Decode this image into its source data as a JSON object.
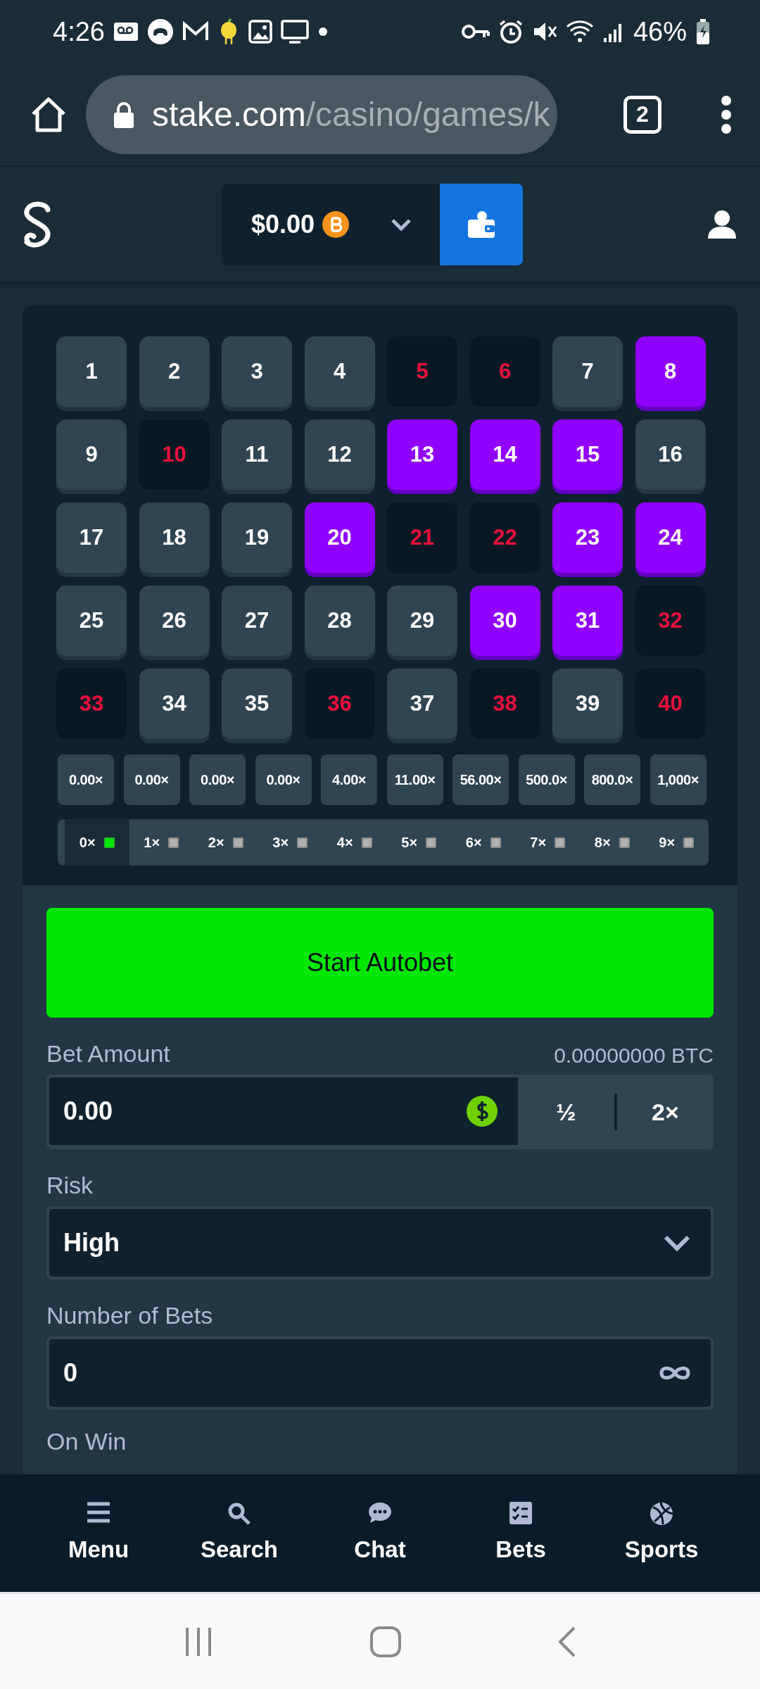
{
  "status_bar": {
    "time": "4:26",
    "battery": "46%"
  },
  "browser": {
    "url_host": "stake.com",
    "url_path": "/casino/games/k",
    "tab_count": "2"
  },
  "header": {
    "balance": "$0.00"
  },
  "board": {
    "rows": [
      {
        "tiles": [
          {
            "number": "1",
            "kind": "closed"
          },
          {
            "number": "2",
            "kind": "closed"
          },
          {
            "number": "3",
            "kind": "closed"
          },
          {
            "number": "4",
            "kind": "closed"
          },
          {
            "number": "5",
            "kind": "miss"
          },
          {
            "number": "6",
            "kind": "miss"
          },
          {
            "number": "7",
            "kind": "closed"
          },
          {
            "number": "8",
            "kind": "selected"
          }
        ]
      },
      {
        "tiles": [
          {
            "number": "9",
            "kind": "closed"
          },
          {
            "number": "10",
            "kind": "miss"
          },
          {
            "number": "11",
            "kind": "closed"
          },
          {
            "number": "12",
            "kind": "closed"
          },
          {
            "number": "13",
            "kind": "selected"
          },
          {
            "number": "14",
            "kind": "selected"
          },
          {
            "number": "15",
            "kind": "selected"
          },
          {
            "number": "16",
            "kind": "closed"
          }
        ]
      },
      {
        "tiles": [
          {
            "number": "17",
            "kind": "closed"
          },
          {
            "number": "18",
            "kind": "closed"
          },
          {
            "number": "19",
            "kind": "closed"
          },
          {
            "number": "20",
            "kind": "selected"
          },
          {
            "number": "21",
            "kind": "miss"
          },
          {
            "number": "22",
            "kind": "miss"
          },
          {
            "number": "23",
            "kind": "selected"
          },
          {
            "number": "24",
            "kind": "selected"
          }
        ]
      },
      {
        "tiles": [
          {
            "number": "25",
            "kind": "closed"
          },
          {
            "number": "26",
            "kind": "closed"
          },
          {
            "number": "27",
            "kind": "closed"
          },
          {
            "number": "28",
            "kind": "closed"
          },
          {
            "number": "29",
            "kind": "closed"
          },
          {
            "number": "30",
            "kind": "selected"
          },
          {
            "number": "31",
            "kind": "selected"
          },
          {
            "number": "32",
            "kind": "miss"
          }
        ]
      },
      {
        "tiles": [
          {
            "number": "33",
            "kind": "miss"
          },
          {
            "number": "34",
            "kind": "closed"
          },
          {
            "number": "35",
            "kind": "closed"
          },
          {
            "number": "36",
            "kind": "miss"
          },
          {
            "number": "37",
            "kind": "closed"
          },
          {
            "number": "38",
            "kind": "miss"
          },
          {
            "number": "39",
            "kind": "closed"
          },
          {
            "number": "40",
            "kind": "miss"
          }
        ]
      }
    ],
    "payouts": [
      "0.00×",
      "0.00×",
      "0.00×",
      "0.00×",
      "4.00×",
      "11.00×",
      "56.00×",
      "500.0×",
      "800.0×",
      "1,000×"
    ],
    "hits": [
      {
        "label": "0×",
        "selected": true
      },
      {
        "label": "1×",
        "selected": false
      },
      {
        "label": "2×",
        "selected": false
      },
      {
        "label": "3×",
        "selected": false
      },
      {
        "label": "4×",
        "selected": false
      },
      {
        "label": "5×",
        "selected": false
      },
      {
        "label": "6×",
        "selected": false
      },
      {
        "label": "7×",
        "selected": false
      },
      {
        "label": "8×",
        "selected": false
      },
      {
        "label": "9×",
        "selected": false
      }
    ]
  },
  "form": {
    "start_button": "Start Autobet",
    "bet_amount": {
      "label": "Bet Amount",
      "btc": "0.00000000 BTC",
      "value": "0.00",
      "half": "½",
      "double": "2×"
    },
    "risk": {
      "label": "Risk",
      "value": "High"
    },
    "bets": {
      "label": "Number of Bets",
      "value": "0"
    },
    "on_win": {
      "label": "On Win"
    }
  },
  "nav": [
    {
      "label": "Menu",
      "kind": "menu"
    },
    {
      "label": "Search",
      "kind": "search"
    },
    {
      "label": "Chat",
      "kind": "chat"
    },
    {
      "label": "Bets",
      "kind": "bets"
    },
    {
      "label": "Sports",
      "kind": "sports"
    }
  ]
}
